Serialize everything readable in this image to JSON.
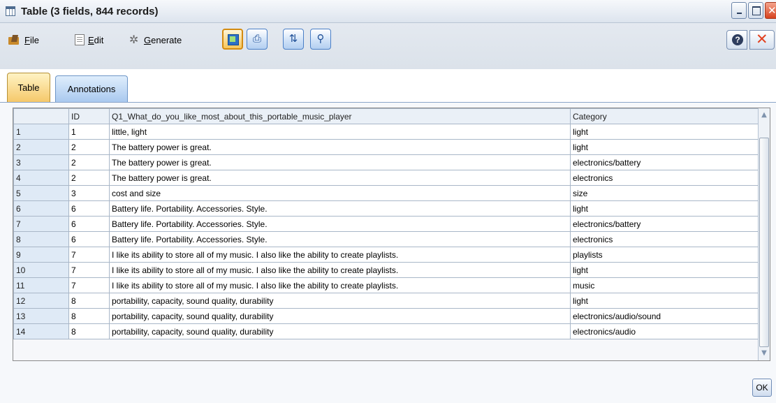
{
  "window": {
    "title": "Table (3 fields, 844 records)"
  },
  "menu": {
    "file": "File",
    "edit": "Edit",
    "generate": "Generate"
  },
  "tabs": [
    "Table",
    "Annotations"
  ],
  "table": {
    "columns": [
      "",
      "ID",
      "Q1_What_do_you_like_most_about_this_portable_music_player",
      "Category"
    ],
    "rows": [
      [
        "1",
        "1",
        "little, light",
        "light"
      ],
      [
        "2",
        "2",
        "The battery power is great.",
        "light"
      ],
      [
        "3",
        "2",
        "The battery power is great.",
        "electronics/battery"
      ],
      [
        "4",
        "2",
        "The battery power is great.",
        "electronics"
      ],
      [
        "5",
        "3",
        "cost and size",
        "size"
      ],
      [
        "6",
        "6",
        "Battery life. Portability. Accessories. Style.",
        "light"
      ],
      [
        "7",
        "6",
        "Battery life. Portability. Accessories. Style.",
        "electronics/battery"
      ],
      [
        "8",
        "6",
        "Battery life. Portability. Accessories. Style.",
        "electronics"
      ],
      [
        "9",
        "7",
        "I like its ability to store all of my music. I also like the ability to create playlists.",
        "playlists"
      ],
      [
        "10",
        "7",
        "I like its ability to store all of my music. I also like the ability to create playlists.",
        "light"
      ],
      [
        "11",
        "7",
        "I like its ability to store all of my music. I also like the ability to create playlists.",
        "music"
      ],
      [
        "12",
        "8",
        "portability, capacity, sound quality, durability",
        "light"
      ],
      [
        "13",
        "8",
        "portability, capacity, sound quality, durability",
        "electronics/audio/sound"
      ],
      [
        "14",
        "8",
        "portability, capacity, sound quality, durability",
        "electronics/audio"
      ]
    ]
  },
  "buttons": {
    "ok": "OK"
  },
  "icons": {
    "window": "table-icon",
    "file": "file-folder-icon",
    "edit": "edit-document-icon",
    "generate": "generate-icon",
    "tools": [
      "table-view-icon",
      "print-icon",
      "sort-icon",
      "find-icon"
    ],
    "help": "help-icon",
    "close": "close-icon"
  },
  "colors": {
    "active_tab": "#f5c86a",
    "inactive_tab": "#a9c9ef",
    "rownum_bg": "#dfeaf6",
    "close_red": "#e2401f"
  }
}
